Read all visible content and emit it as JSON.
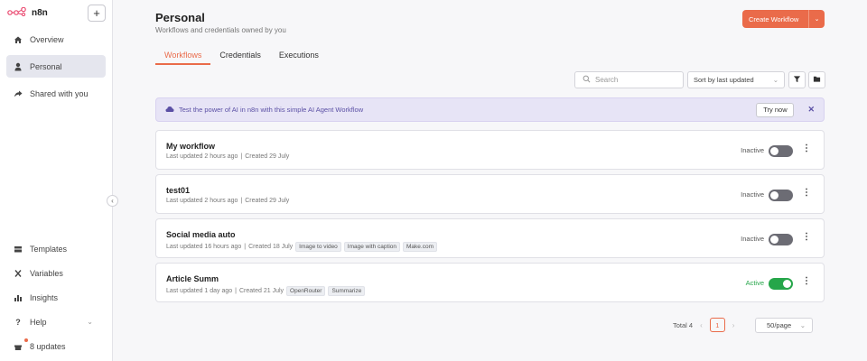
{
  "brand": {
    "name": "n8n",
    "add_label": "+"
  },
  "sidebar": {
    "top_items": [
      {
        "label": "Overview",
        "icon": "home-icon"
      },
      {
        "label": "Personal",
        "icon": "user-icon"
      },
      {
        "label": "Shared with you",
        "icon": "share-icon"
      }
    ],
    "bottom_items": [
      {
        "label": "Templates",
        "icon": "templates-icon"
      },
      {
        "label": "Variables",
        "icon": "variables-icon"
      },
      {
        "label": "Insights",
        "icon": "insights-icon"
      },
      {
        "label": "Help",
        "icon": "help-icon"
      },
      {
        "label": "8 updates",
        "icon": "gift-icon"
      }
    ]
  },
  "header": {
    "title": "Personal",
    "subtitle": "Workflows and credentials owned by you",
    "create_label": "Create Workflow"
  },
  "tabs": [
    {
      "label": "Workflows"
    },
    {
      "label": "Credentials"
    },
    {
      "label": "Executions"
    }
  ],
  "toolbar": {
    "search_placeholder": "Search",
    "sort_value": "Sort by last updated"
  },
  "banner": {
    "text": "Test the power of AI in n8n with this simple AI Agent Workflow",
    "button_label": "Try now",
    "close_label": "✕"
  },
  "workflows": [
    {
      "name": "My workflow",
      "updated": "Last updated 2 hours ago",
      "created": "Created 29 July",
      "tags": [],
      "status": "Inactive",
      "active": false
    },
    {
      "name": "test01",
      "updated": "Last updated 2 hours ago",
      "created": "Created 29 July",
      "tags": [],
      "status": "Inactive",
      "active": false
    },
    {
      "name": "Social media auto",
      "updated": "Last updated 16 hours ago",
      "created": "Created 18 July",
      "tags": [
        "Image to video",
        "Image with caption",
        "Make.com"
      ],
      "status": "Inactive",
      "active": false
    },
    {
      "name": "Article Summ",
      "updated": "Last updated 1 day ago",
      "created": "Created 21 July",
      "tags": [
        "OpenRouter",
        "Summarize"
      ],
      "status": "Active",
      "active": true
    }
  ],
  "pagination": {
    "total": "Total 4",
    "page": "1",
    "per_page": "50/page"
  },
  "colors": {
    "accent": "#ea6b4a",
    "active": "#26a64a",
    "banner": "#e7e4f6"
  }
}
